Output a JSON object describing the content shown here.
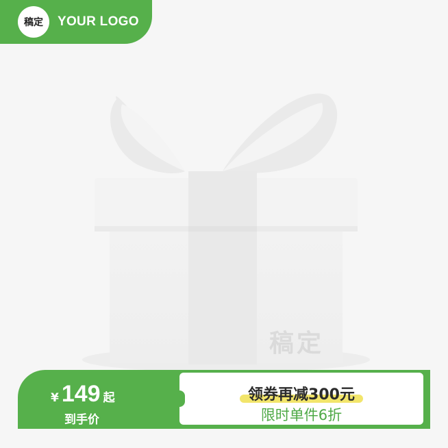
{
  "logo": {
    "badge_text": "稿定",
    "text": "YOUR LOGO"
  },
  "watermark": "稿定",
  "price": {
    "currency": "¥",
    "amount": "149",
    "suffix": "起",
    "label": "到手价"
  },
  "coupon": {
    "line1": "领券再减300元",
    "line2": "限时单件6折"
  },
  "colors": {
    "brand_green": "#56b04b",
    "highlight_yellow": "#f2e56b",
    "background": "#f6f6f6"
  },
  "icons": [
    "gift-box-image"
  ]
}
